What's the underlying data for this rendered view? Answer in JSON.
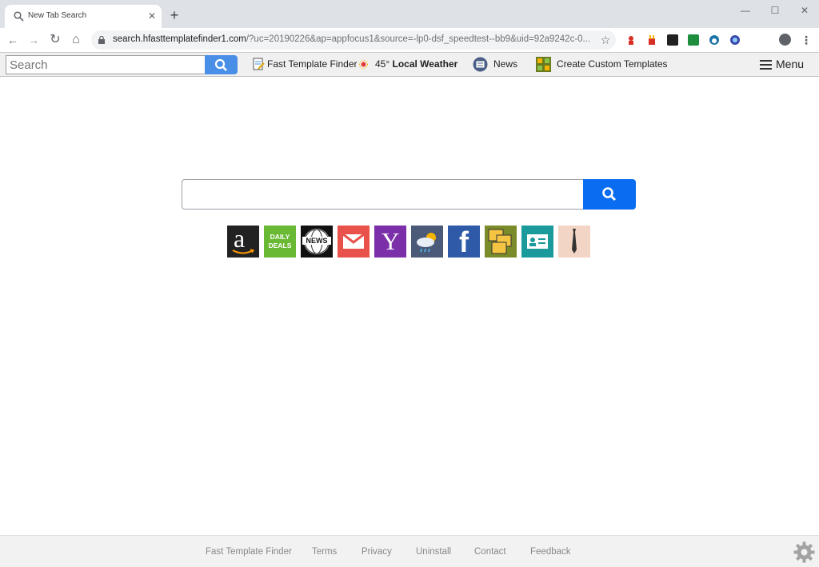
{
  "tab": {
    "title": "New Tab Search",
    "close": "✕",
    "new_tab": "+"
  },
  "window_controls": {
    "minimize": "—",
    "maximize": "☐",
    "close": "✕"
  },
  "nav": {
    "back": "←",
    "forward": "→",
    "reload": "↻",
    "home": "⌂"
  },
  "omnibox": {
    "host": "search.hfasttemplatefinder1.com",
    "path": "/?uc=20190226&ap=appfocus1&source=-lp0-dsf_speedtest--bb9&uid=92a9242c-0..."
  },
  "extension_bar": {
    "search_placeholder": "Search",
    "template_finder": "Fast Template Finder",
    "temperature": "45°",
    "weather": "Local Weather",
    "news": "News",
    "create_templates": "Create Custom Templates",
    "menu": "Menu"
  },
  "tiles": [
    {
      "name": "amazon",
      "label": "a",
      "color": "#222222"
    },
    {
      "name": "daily-deals",
      "label": "DAILY DEALS",
      "color": "#6ab934"
    },
    {
      "name": "news",
      "label": "NEWS",
      "color": "#111111"
    },
    {
      "name": "gmail",
      "label": "",
      "color": "#e8524a"
    },
    {
      "name": "yahoo",
      "label": "Y",
      "color": "#7b2fa8"
    },
    {
      "name": "weather",
      "label": "",
      "color": "#4a5a78"
    },
    {
      "name": "facebook",
      "label": "f",
      "color": "#2f5aa8"
    },
    {
      "name": "templates",
      "label": "",
      "color": "#7a8b2a"
    },
    {
      "name": "id-card",
      "label": "",
      "color": "#1a9a9a"
    },
    {
      "name": "tie",
      "label": "",
      "color": "#f2d5c4"
    }
  ],
  "footer": {
    "links": [
      "Fast Template Finder",
      "Terms",
      "Privacy",
      "Uninstall",
      "Contact",
      "Feedback"
    ]
  }
}
